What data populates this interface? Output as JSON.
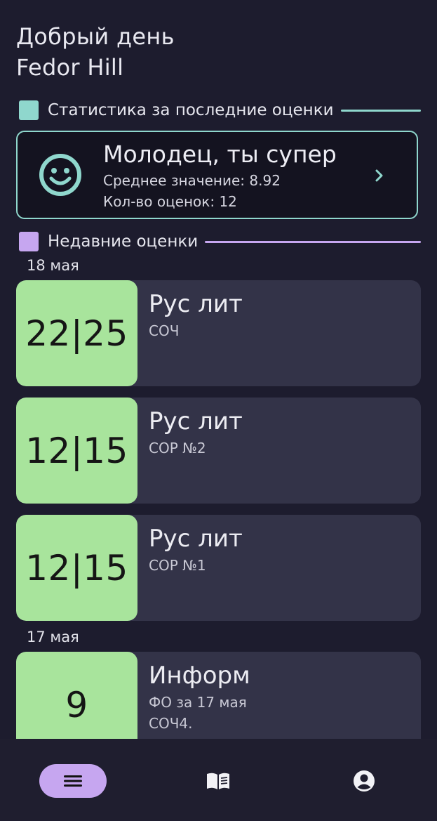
{
  "header": {
    "greeting": "Добрый день",
    "user_name": "Fedor Hill"
  },
  "stats_section": {
    "title": "Статистика за последние оценки",
    "accent_color": "#8fd7cd",
    "card": {
      "icon": "smiley-face-icon",
      "title": "Молодец, ты супер",
      "average_line": "Среднее значение: 8.92",
      "count_line": "Кол-во оценок: 12",
      "chevron_icon": "chevron-right-icon"
    }
  },
  "recent_section": {
    "title": "Недавние оценки",
    "accent_color": "#c6a6f0"
  },
  "grade_groups": [
    {
      "date": "18 мая",
      "grades": [
        {
          "score": "22|25",
          "subject": "Рус лит",
          "type_lines": [
            "СОЧ"
          ]
        },
        {
          "score": "12|15",
          "subject": "Рус лит",
          "type_lines": [
            "СОР №2"
          ]
        },
        {
          "score": "12|15",
          "subject": "Рус лит",
          "type_lines": [
            "СОР №1"
          ]
        }
      ]
    },
    {
      "date": "17 мая",
      "grades": [
        {
          "score": "9",
          "subject": "Информ",
          "type_lines": [
            "ФО за 17 мая",
            "СОЧ4."
          ]
        }
      ]
    }
  ],
  "bottom_nav": {
    "items": [
      {
        "icon": "menu-icon",
        "active": true
      },
      {
        "icon": "book-icon",
        "active": false
      },
      {
        "icon": "profile-icon",
        "active": false
      }
    ],
    "active_color": "#c6a6f0"
  }
}
